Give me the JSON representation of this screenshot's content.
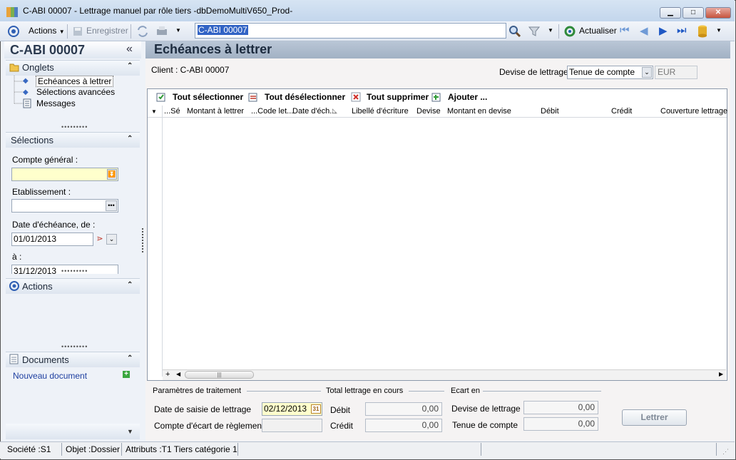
{
  "window": {
    "title": "C-ABI 00007 -  Lettrage manuel par rôle tiers -dbDemoMultiV650_Prod-",
    "minimize": "▁",
    "maximize": "□",
    "close": "✕"
  },
  "toolbar": {
    "actions_label": "Actions",
    "save_label": "Enregistrer",
    "search_value": "C-ABI 00007",
    "refresh_label": "Actualiser"
  },
  "left": {
    "record_title": "C-ABI 00007",
    "collapse": "«",
    "tabs_section": "Onglets",
    "tabs": [
      "Echéances à lettrer",
      "Sélections avancées",
      "Messages"
    ],
    "selections_section": "Sélections",
    "compte_general_label": "Compte général :",
    "compte_general_value": "",
    "etablissement_label": "Etablissement :",
    "etablissement_value": "",
    "date_from_label": "Date d'échéance, de :",
    "date_from_value": "01/01/2013",
    "date_to_label": "à :",
    "date_to_value": "31/12/2013",
    "actions_section": "Actions",
    "documents_section": "Documents",
    "new_document": "Nouveau document"
  },
  "main": {
    "title": "Echéances à lettrer",
    "client_label": "Client : C-ABI 00007",
    "devise_label": "Devise de lettrage :",
    "devise_value": "Tenue de compte",
    "devise_code": "EUR",
    "grid_tools": {
      "select_all": "Tout sélectionner",
      "deselect_all": "Tout désélectionner",
      "delete_all": "Tout supprimer",
      "add": "Ajouter ..."
    },
    "columns": [
      "...Sé",
      "Montant à lettrer",
      "...Code let...",
      "Date d'éch...",
      "Libellé d'écriture",
      "Devise",
      "Montant en devise",
      "Débit",
      "Crédit",
      "Couverture lettrage"
    ],
    "params": {
      "section": "Paramètres de traitement",
      "date_label": "Date de saisie de lettrage",
      "date_value": "02/12/2013",
      "ecart_label": "Compte d'écart de règlement",
      "ecart_value": ""
    },
    "total": {
      "section": "Total lettrage en cours",
      "debit_label": "Débit",
      "debit_value": "0,00",
      "credit_label": "Crédit",
      "credit_value": "0,00"
    },
    "ecart": {
      "section": "Ecart en",
      "devise_label": "Devise de lettrage",
      "devise_value": "0,00",
      "tenue_label": "Tenue de compte",
      "tenue_value": "0,00"
    },
    "lettrer_button": "Lettrer"
  },
  "status": {
    "societe": "Société :S1",
    "objet": "Objet :Dossier",
    "attributs": "Attributs :T1 Tiers catégorie 1"
  },
  "colors": {
    "accent": "#3163c5",
    "header": "#a9b7c9",
    "field_required": "#ffffcc"
  }
}
